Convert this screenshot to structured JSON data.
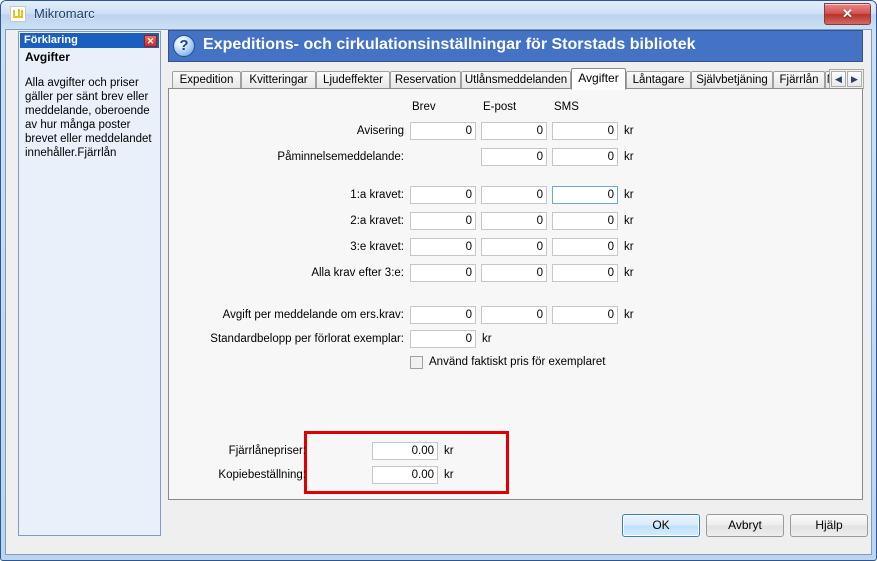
{
  "window": {
    "title": "Mikromarc",
    "icon": "mikromarc-logo-icon",
    "close_label": "✕"
  },
  "explanation_panel": {
    "title": "Förklaring",
    "close_label": "✕",
    "subtitle": "Avgifter",
    "body": "Alla avgifter och priser gäller per sänt brev eller meddelande, oberoende av hur många poster brevet eller meddelandet innehåller.Fjärrlån"
  },
  "dialog": {
    "help_icon": "?",
    "title": "Expeditions- och cirkulationsinställningar för Storstads bibliotek"
  },
  "tabs": {
    "items": [
      {
        "label": "Expedition",
        "active": false
      },
      {
        "label": "Kvitteringar",
        "active": false
      },
      {
        "label": "Ljudeffekter",
        "active": false
      },
      {
        "label": "Reservation",
        "active": false
      },
      {
        "label": "Utlånsmeddelanden",
        "active": false
      },
      {
        "label": "Avgifter",
        "active": true
      },
      {
        "label": "Låntagare",
        "active": false
      },
      {
        "label": "Självbetjäning",
        "active": false
      },
      {
        "label": "Fjärrlån",
        "active": false
      },
      {
        "label": "Namn-",
        "active": false
      }
    ],
    "scroll_left": "◀",
    "scroll_right": "▶"
  },
  "form": {
    "column_headers": [
      "Brev",
      "E-post",
      "SMS"
    ],
    "currency_suffix": "kr",
    "rows": [
      {
        "label": "Avisering",
        "brev": "0",
        "epost": "0",
        "sms": "0",
        "has_brev": true,
        "focused": ""
      },
      {
        "label": "Påminnelsemeddelande:",
        "brev": "",
        "epost": "0",
        "sms": "0",
        "has_brev": false,
        "focused": ""
      },
      {
        "label": "1:a kravet:",
        "brev": "0",
        "epost": "0",
        "sms": "0",
        "has_brev": true,
        "focused": "sms"
      },
      {
        "label": "2:a kravet:",
        "brev": "0",
        "epost": "0",
        "sms": "0",
        "has_brev": true,
        "focused": ""
      },
      {
        "label": "3:e kravet:",
        "brev": "0",
        "epost": "0",
        "sms": "0",
        "has_brev": true,
        "focused": ""
      },
      {
        "label": "Alla krav efter 3:e:",
        "brev": "0",
        "epost": "0",
        "sms": "0",
        "has_brev": true,
        "focused": ""
      },
      {
        "label": "Avgift per meddelande om ers.krav:",
        "brev": "0",
        "epost": "0",
        "sms": "0",
        "has_brev": true,
        "focused": ""
      }
    ],
    "standard_amount": {
      "label": "Standardbelopp per förlorat exemplar:",
      "value": "0",
      "suffix": "kr"
    },
    "actual_price_checkbox": {
      "label": "Använd faktiskt pris för exemplaret",
      "checked": false
    }
  },
  "highlighted_box": {
    "border_color": "#e00000",
    "rows": [
      {
        "label": "Fjärrlånepriser:",
        "value": "0.00",
        "suffix": "kr"
      },
      {
        "label": "Kopiebeställning:",
        "value": "0.00",
        "suffix": "kr"
      }
    ]
  },
  "footer": {
    "ok_label": "OK",
    "cancel_label": "Avbryt",
    "help_label": "Hjälp"
  }
}
